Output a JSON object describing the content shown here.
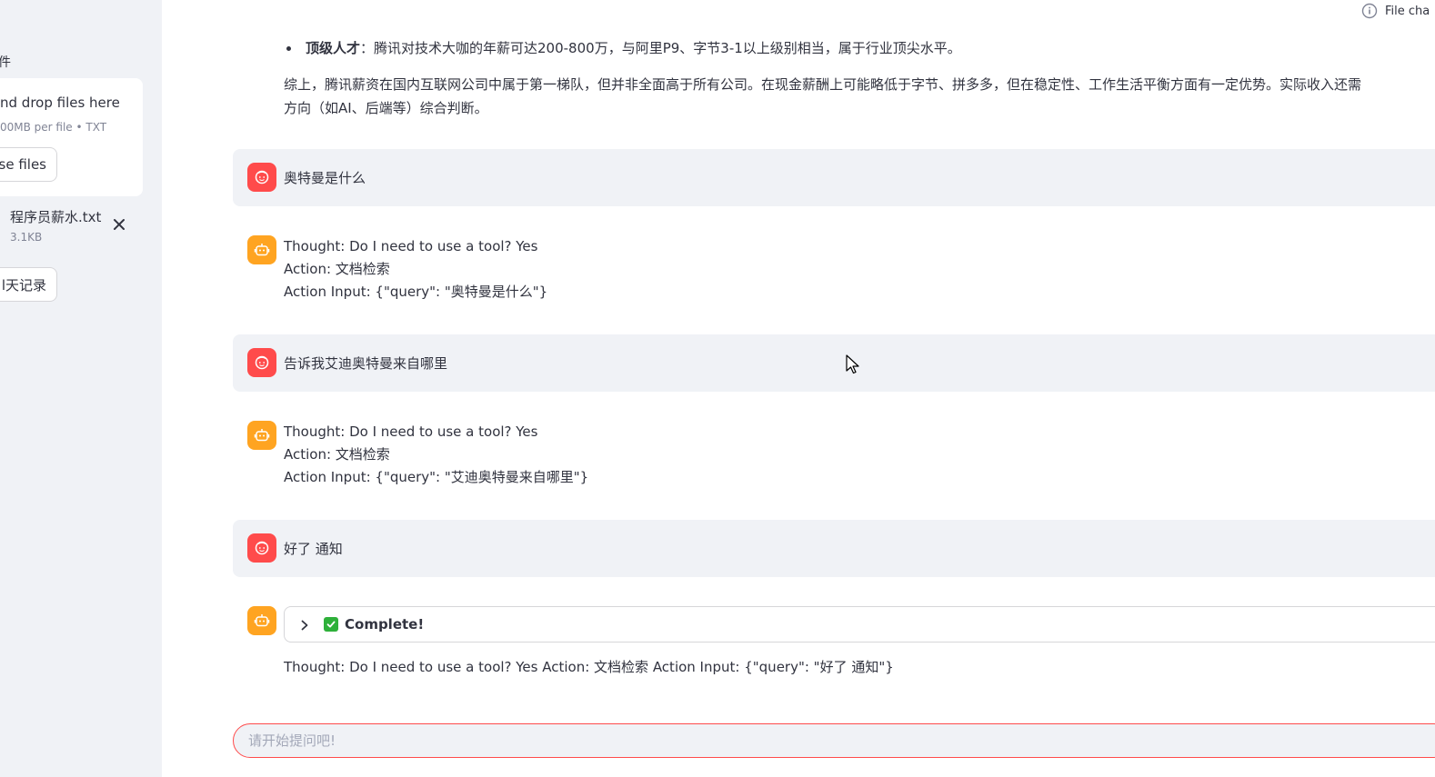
{
  "sidebar": {
    "uploader_label": "件",
    "dropzone_title": "nd drop files here",
    "dropzone_limits": "00MB per file • TXT",
    "browse_button": "vse files",
    "file": {
      "name": "程序员薪水.txt",
      "size": "3.1KB"
    },
    "history_button": "l天记录"
  },
  "status": {
    "file_change": "File cha"
  },
  "previous_answer": {
    "bullet_bold": "顶级人才",
    "bullet_text": "：腾讯对技术大咖的年薪可达200-800万，与阿里P9、字节3-1以上级别相当，属于行业顶尖水平。",
    "summary": "综上，腾讯薪资在国内互联网公司中属于第一梯队，但并非全面高于所有公司。在现金薪酬上可能略低于字节、拼多多，但在稳定性、工作生活平衡方面有一定优势。实际收入还需",
    "summary_line2": "方向（如AI、后端等）综合判断。"
  },
  "messages": [
    {
      "role": "user",
      "text": "奥特曼是什么"
    },
    {
      "role": "assistant",
      "lines": [
        "Thought: Do I need to use a tool? Yes",
        "Action: 文档检索",
        "Action Input: {\"query\": \"奥特曼是什么\"}"
      ]
    },
    {
      "role": "user",
      "text": "告诉我艾迪奥特曼来自哪里"
    },
    {
      "role": "assistant",
      "lines": [
        "Thought: Do I need to use a tool? Yes",
        "Action: 文档检索",
        "Action Input: {\"query\": \"艾迪奥特曼来自哪里\"}"
      ]
    },
    {
      "role": "user",
      "text": "好了 通知"
    },
    {
      "role": "assistant",
      "status_label": "Complete!",
      "text": "Thought: Do I need to use a tool? Yes Action: 文档检索 Action Input: {\"query\": \"好了 通知\"}"
    }
  ],
  "chat_input": {
    "placeholder": "请开始提问吧!"
  },
  "colors": {
    "accent": "#ff4b4b",
    "bot_avatar": "#ffa421",
    "sidebar_bg": "#f0f2f6"
  }
}
